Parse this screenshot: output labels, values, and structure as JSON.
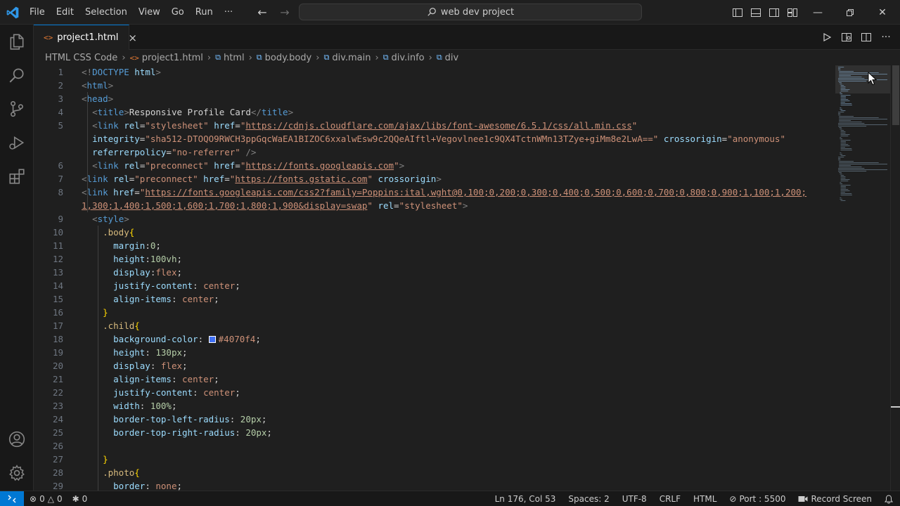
{
  "titlebar": {
    "menu": [
      "File",
      "Edit",
      "Selection",
      "View",
      "Go",
      "Run",
      "···"
    ],
    "back_icon": "arrow-left-icon",
    "forward_icon": "arrow-right-icon",
    "search_text": "web dev project"
  },
  "tabs": {
    "active": {
      "label": "project1.html",
      "icon": "html-file-icon",
      "close": "×"
    }
  },
  "breadcrumb": {
    "items": [
      "HTML CSS Code",
      "project1.html",
      "html",
      "body.body",
      "div.main",
      "div.info",
      "div"
    ]
  },
  "editor": {
    "line_numbers": [
      "1",
      "2",
      "3",
      "4",
      "5",
      "",
      "",
      "6",
      "7",
      "8",
      "",
      "9",
      "10",
      "11",
      "12",
      "13",
      "14",
      "15",
      "16",
      "17",
      "18",
      "19",
      "20",
      "21",
      "22",
      "23",
      "24",
      "25",
      "26",
      "27",
      "28",
      "29"
    ],
    "lines": [
      [
        [
          "t-punc",
          "<!"
        ],
        [
          "t-tag",
          "DOCTYPE"
        ],
        [
          "t-text",
          " "
        ],
        [
          "t-attr",
          "html"
        ],
        [
          "t-punc",
          ">"
        ]
      ],
      [
        [
          "t-punc",
          "<"
        ],
        [
          "t-tag",
          "html"
        ],
        [
          "t-punc",
          ">"
        ]
      ],
      [
        [
          "t-punc",
          "<"
        ],
        [
          "t-tag",
          "head"
        ],
        [
          "t-punc",
          ">"
        ]
      ],
      [
        [
          "t-text",
          "  "
        ],
        [
          "t-punc",
          "<"
        ],
        [
          "t-tag",
          "title"
        ],
        [
          "t-punc",
          ">"
        ],
        [
          "t-text",
          "Responsive Profile Card"
        ],
        [
          "t-punc",
          "</"
        ],
        [
          "t-tag",
          "title"
        ],
        [
          "t-punc",
          ">"
        ]
      ],
      [
        [
          "t-text",
          "  "
        ],
        [
          "t-punc",
          "<"
        ],
        [
          "t-tag",
          "link"
        ],
        [
          "t-text",
          " "
        ],
        [
          "t-attr",
          "rel"
        ],
        [
          "t-text",
          "="
        ],
        [
          "t-str",
          "\"stylesheet\""
        ],
        [
          "t-text",
          " "
        ],
        [
          "t-attr",
          "href"
        ],
        [
          "t-text",
          "="
        ],
        [
          "t-str",
          "\""
        ],
        [
          "t-link",
          "https://cdnjs.cloudflare.com/ajax/libs/font-awesome/6.5.1/css/all.min.css"
        ],
        [
          "t-str",
          "\""
        ]
      ],
      [
        [
          "t-text",
          "  "
        ],
        [
          "t-attr",
          "integrity"
        ],
        [
          "t-text",
          "="
        ],
        [
          "t-str",
          "\"sha512-DTOQO9RWCH3ppGqcWaEA1BIZOC6xxalwEsw9c2QQeAIftl+Vegovlnee1c9QX4TctnWMn13TZye+giMm8e2LwA==\""
        ],
        [
          "t-text",
          " "
        ],
        [
          "t-attr",
          "crossorigin"
        ],
        [
          "t-text",
          "="
        ],
        [
          "t-str",
          "\"anonymous\""
        ]
      ],
      [
        [
          "t-text",
          "  "
        ],
        [
          "t-attr",
          "referrerpolicy"
        ],
        [
          "t-text",
          "="
        ],
        [
          "t-str",
          "\"no-referrer\""
        ],
        [
          "t-text",
          " "
        ],
        [
          "t-punc",
          "/>"
        ]
      ],
      [
        [
          "t-text",
          "  "
        ],
        [
          "t-punc",
          "<"
        ],
        [
          "t-tag",
          "link"
        ],
        [
          "t-text",
          " "
        ],
        [
          "t-attr",
          "rel"
        ],
        [
          "t-text",
          "="
        ],
        [
          "t-str",
          "\"preconnect\""
        ],
        [
          "t-text",
          " "
        ],
        [
          "t-attr",
          "href"
        ],
        [
          "t-text",
          "="
        ],
        [
          "t-str",
          "\""
        ],
        [
          "t-link",
          "https://fonts.googleapis.com"
        ],
        [
          "t-str",
          "\""
        ],
        [
          "t-punc",
          ">"
        ]
      ],
      [
        [
          "t-punc",
          "<"
        ],
        [
          "t-tag",
          "link"
        ],
        [
          "t-text",
          " "
        ],
        [
          "t-attr",
          "rel"
        ],
        [
          "t-text",
          "="
        ],
        [
          "t-str",
          "\"preconnect\""
        ],
        [
          "t-text",
          " "
        ],
        [
          "t-attr",
          "href"
        ],
        [
          "t-text",
          "="
        ],
        [
          "t-str",
          "\""
        ],
        [
          "t-link",
          "https://fonts.gstatic.com"
        ],
        [
          "t-str",
          "\""
        ],
        [
          "t-text",
          " "
        ],
        [
          "t-attr",
          "crossorigin"
        ],
        [
          "t-punc",
          ">"
        ]
      ],
      [
        [
          "t-punc",
          "<"
        ],
        [
          "t-tag",
          "link"
        ],
        [
          "t-text",
          " "
        ],
        [
          "t-attr",
          "href"
        ],
        [
          "t-text",
          "="
        ],
        [
          "t-str",
          "\""
        ],
        [
          "t-link",
          "https://fonts.googleapis.com/css2?family=Poppins:ital,wght@0,100;0,200;0,300;0,400;0,500;0,600;0,700;0,800;0,900;1,100;1,200;"
        ]
      ],
      [
        [
          "t-link",
          "1,300;1,400;1,500;1,600;1,700;1,800;1,900&display=swap"
        ],
        [
          "t-str",
          "\""
        ],
        [
          "t-text",
          " "
        ],
        [
          "t-attr",
          "rel"
        ],
        [
          "t-text",
          "="
        ],
        [
          "t-str",
          "\"stylesheet\""
        ],
        [
          "t-punc",
          ">"
        ]
      ],
      [
        [
          "t-text",
          "  "
        ],
        [
          "t-punc",
          "<"
        ],
        [
          "t-tag",
          "style"
        ],
        [
          "t-punc",
          ">"
        ]
      ],
      [
        [
          "t-text",
          "    "
        ],
        [
          "t-sel",
          ".body"
        ],
        [
          "t-brace",
          "{"
        ]
      ],
      [
        [
          "t-text",
          "      "
        ],
        [
          "t-prop",
          "margin"
        ],
        [
          "t-colon",
          ":"
        ],
        [
          "t-num",
          "0"
        ],
        [
          "t-colon",
          ";"
        ]
      ],
      [
        [
          "t-text",
          "      "
        ],
        [
          "t-prop",
          "height"
        ],
        [
          "t-colon",
          ":"
        ],
        [
          "t-num",
          "100vh"
        ],
        [
          "t-colon",
          ";"
        ]
      ],
      [
        [
          "t-text",
          "      "
        ],
        [
          "t-prop",
          "display"
        ],
        [
          "t-colon",
          ":"
        ],
        [
          "t-val",
          "flex"
        ],
        [
          "t-colon",
          ";"
        ]
      ],
      [
        [
          "t-text",
          "      "
        ],
        [
          "t-prop",
          "justify-content"
        ],
        [
          "t-colon",
          ": "
        ],
        [
          "t-val",
          "center"
        ],
        [
          "t-colon",
          ";"
        ]
      ],
      [
        [
          "t-text",
          "      "
        ],
        [
          "t-prop",
          "align-items"
        ],
        [
          "t-colon",
          ": "
        ],
        [
          "t-val",
          "center"
        ],
        [
          "t-colon",
          ";"
        ]
      ],
      [
        [
          "t-text",
          "    "
        ],
        [
          "t-brace",
          "}"
        ]
      ],
      [
        [
          "t-text",
          "    "
        ],
        [
          "t-sel",
          ".child"
        ],
        [
          "t-brace",
          "{"
        ]
      ],
      [
        [
          "t-text",
          "      "
        ],
        [
          "t-prop",
          "background-color"
        ],
        [
          "t-colon",
          ": "
        ],
        [
          "swatch",
          "#4070f4"
        ],
        [
          "t-val",
          "#4070f4"
        ],
        [
          "t-colon",
          ";"
        ]
      ],
      [
        [
          "t-text",
          "      "
        ],
        [
          "t-prop",
          "height"
        ],
        [
          "t-colon",
          ": "
        ],
        [
          "t-num",
          "130px"
        ],
        [
          "t-colon",
          ";"
        ]
      ],
      [
        [
          "t-text",
          "      "
        ],
        [
          "t-prop",
          "display"
        ],
        [
          "t-colon",
          ": "
        ],
        [
          "t-val",
          "flex"
        ],
        [
          "t-colon",
          ";"
        ]
      ],
      [
        [
          "t-text",
          "      "
        ],
        [
          "t-prop",
          "align-items"
        ],
        [
          "t-colon",
          ": "
        ],
        [
          "t-val",
          "center"
        ],
        [
          "t-colon",
          ";"
        ]
      ],
      [
        [
          "t-text",
          "      "
        ],
        [
          "t-prop",
          "justify-content"
        ],
        [
          "t-colon",
          ": "
        ],
        [
          "t-val",
          "center"
        ],
        [
          "t-colon",
          ";"
        ]
      ],
      [
        [
          "t-text",
          "      "
        ],
        [
          "t-prop",
          "width"
        ],
        [
          "t-colon",
          ": "
        ],
        [
          "t-num",
          "100%"
        ],
        [
          "t-colon",
          ";"
        ]
      ],
      [
        [
          "t-text",
          "      "
        ],
        [
          "t-prop",
          "border-top-left-radius"
        ],
        [
          "t-colon",
          ": "
        ],
        [
          "t-num",
          "20px"
        ],
        [
          "t-colon",
          ";"
        ]
      ],
      [
        [
          "t-text",
          "      "
        ],
        [
          "t-prop",
          "border-top-right-radius"
        ],
        [
          "t-colon",
          ": "
        ],
        [
          "t-num",
          "20px"
        ],
        [
          "t-colon",
          ";"
        ]
      ],
      [
        [
          "t-text",
          ""
        ]
      ],
      [
        [
          "t-text",
          "    "
        ],
        [
          "t-brace",
          "}"
        ]
      ],
      [
        [
          "t-text",
          "    "
        ],
        [
          "t-sel",
          ".photo"
        ],
        [
          "t-brace",
          "{"
        ]
      ],
      [
        [
          "t-text",
          "      "
        ],
        [
          "t-prop",
          "border"
        ],
        [
          "t-colon",
          ": "
        ],
        [
          "t-val",
          "none"
        ],
        [
          "t-colon",
          ";"
        ]
      ]
    ]
  },
  "statusbar": {
    "errors": "0",
    "warnings": "0",
    "ports": "0",
    "position": "Ln 176, Col 53",
    "spaces": "Spaces: 2",
    "encoding": "UTF-8",
    "eol": "CRLF",
    "language": "HTML",
    "port": "Port : 5500",
    "record": "Record Screen"
  },
  "colors": {
    "accent": "#0078d4",
    "swatch": "#4070f4"
  }
}
